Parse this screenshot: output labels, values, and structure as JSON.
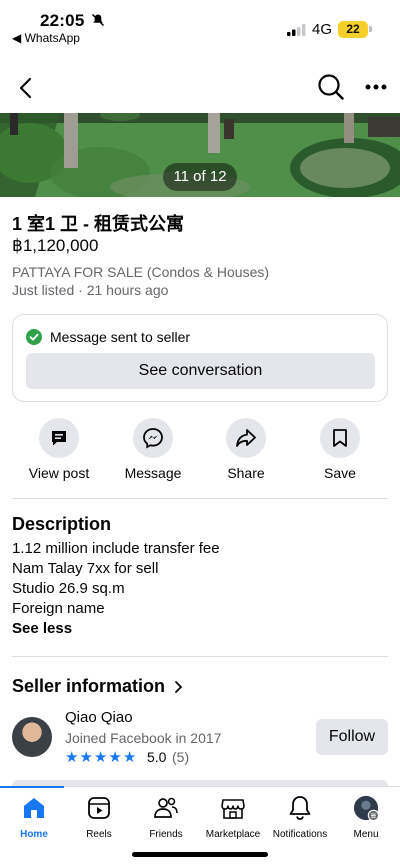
{
  "status_bar": {
    "time": "22:05",
    "back_app": "◀ WhatsApp",
    "network": "4G",
    "battery": "22"
  },
  "nav": {
    "back_icon": "chevron-left-icon",
    "search_icon": "search-icon",
    "more_icon": "more-horizontal-icon"
  },
  "photo": {
    "counter": "11 of 12"
  },
  "listing": {
    "title": "1 室1 卫 - 租赁式公寓",
    "price": "฿1,120,000",
    "group": "PATTAYA FOR SALE (Condos & Houses)",
    "listed": "Just listed · 21 hours ago"
  },
  "message_box": {
    "status": "Message sent to seller",
    "button": "See conversation",
    "status_color": "#31a24c"
  },
  "actions": [
    {
      "label": "View post",
      "icon": "view-post-icon"
    },
    {
      "label": "Message",
      "icon": "messenger-icon"
    },
    {
      "label": "Share",
      "icon": "share-icon"
    },
    {
      "label": "Save",
      "icon": "bookmark-icon"
    }
  ],
  "description": {
    "heading": "Description",
    "lines": [
      "1.12 million include transfer fee",
      "Nam Talay 7xx for sell",
      "Studio 26.9 sq.m",
      "Foreign name"
    ],
    "toggle": "See less"
  },
  "seller": {
    "heading": "Seller information",
    "name": "Qiao Qiao",
    "joined": "Joined Facebook in 2017",
    "stars": [
      "★",
      "★",
      "★",
      "★",
      "★"
    ],
    "rating": "5.0",
    "rating_count": "(5)",
    "follow": "Follow"
  },
  "tabbar": {
    "accent": "#1877f2",
    "items": [
      {
        "label": "Home",
        "icon": "home-icon",
        "active": true
      },
      {
        "label": "Reels",
        "icon": "reels-icon"
      },
      {
        "label": "Friends",
        "icon": "friends-icon"
      },
      {
        "label": "Marketplace",
        "icon": "marketplace-icon"
      },
      {
        "label": "Notifications",
        "icon": "bell-icon"
      },
      {
        "label": "Menu",
        "icon": "menu-avatar-icon"
      }
    ]
  }
}
